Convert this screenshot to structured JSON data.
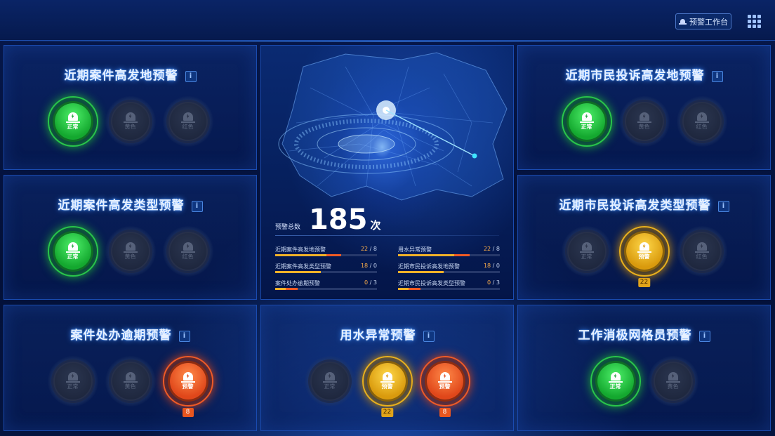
{
  "header": {
    "workbench_label": "预警工作台"
  },
  "colors": {
    "green": "#29c64a",
    "yellow": "#e9b01c",
    "red": "#ef5a26",
    "off": "#2b3650",
    "frame": "#1a4bb0"
  },
  "panels": [
    {
      "title": "近期案件高发地预警",
      "info": "i",
      "lights": [
        {
          "state": "green",
          "label": "正常"
        },
        {
          "state": "off",
          "label": "黄色"
        },
        {
          "state": "off",
          "label": "红色"
        }
      ]
    },
    {
      "title": "近期案件高发类型预警",
      "info": "i",
      "lights": [
        {
          "state": "green",
          "label": "正常"
        },
        {
          "state": "off",
          "label": "黄色"
        },
        {
          "state": "off",
          "label": "红色"
        }
      ]
    },
    {
      "title": "案件处办逾期预警",
      "info": "i",
      "lights": [
        {
          "state": "off",
          "label": "正常"
        },
        {
          "state": "off",
          "label": "黄色"
        },
        {
          "state": "red",
          "label": "预警",
          "badge": "8"
        }
      ]
    },
    {
      "title": "近期市民投诉高发地预警",
      "info": "i",
      "lights": [
        {
          "state": "green",
          "label": "正常"
        },
        {
          "state": "off",
          "label": "黄色"
        },
        {
          "state": "off",
          "label": "红色"
        }
      ]
    },
    {
      "title": "近期市民投诉高发类型预警",
      "info": "i",
      "lights": [
        {
          "state": "off",
          "label": "正常"
        },
        {
          "state": "yellow",
          "label": "预警",
          "badge": "22"
        },
        {
          "state": "off",
          "label": "红色"
        }
      ]
    },
    {
      "title": "工作消极网格员预警",
      "info": "i",
      "lights": [
        {
          "state": "green",
          "label": "正常"
        },
        {
          "state": "off",
          "label": "黄色"
        }
      ]
    },
    {
      "title": "用水异常预警",
      "info": "i",
      "lights": [
        {
          "state": "off",
          "label": "正常"
        },
        {
          "state": "yellow",
          "label": "预警",
          "badge": "22"
        },
        {
          "state": "red",
          "label": "预警",
          "badge": "8"
        }
      ]
    }
  ],
  "summary": {
    "label": "预警总数",
    "total": "185",
    "unit": "次",
    "stats": [
      {
        "name": "近期案件高发地预警",
        "a": "22",
        "b": "8",
        "yellow": 0.5,
        "red": 0.15
      },
      {
        "name": "用水异常预警",
        "a": "22",
        "b": "8",
        "yellow": 0.55,
        "red": 0.15
      },
      {
        "name": "近期案件高发类型预警",
        "a": "18",
        "b": "0",
        "yellow": 0.45,
        "red": 0
      },
      {
        "name": "近期市民投诉高发地预警",
        "a": "18",
        "b": "0",
        "yellow": 0.45,
        "red": 0
      },
      {
        "name": "案件处办逾期预警",
        "a": "0",
        "b": "3",
        "yellow": 0.1,
        "red": 0.12
      },
      {
        "name": "近期市民投诉高发类型预警",
        "a": "0",
        "b": "3",
        "yellow": 0.1,
        "red": 0.12
      }
    ]
  }
}
